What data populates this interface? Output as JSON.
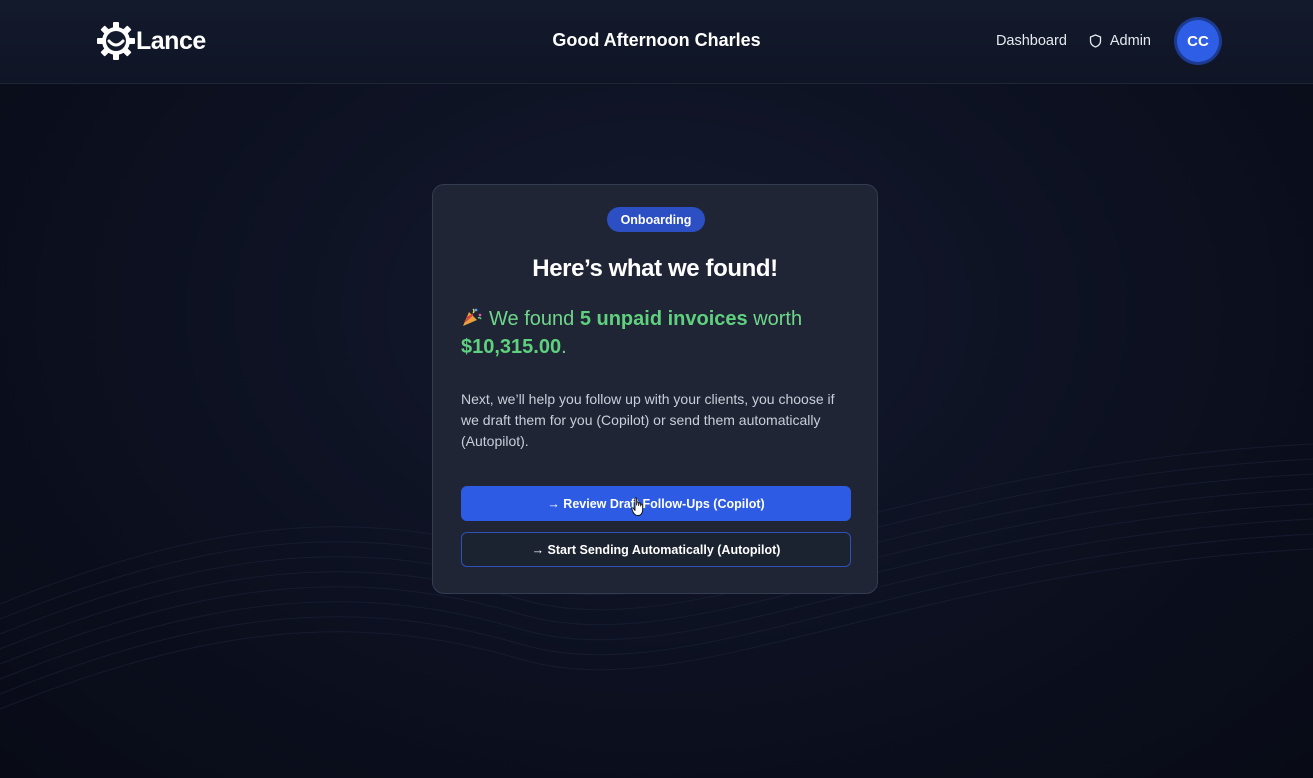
{
  "header": {
    "logo_text": "Lance",
    "greeting": "Good Afternoon Charles",
    "nav": {
      "dashboard_label": "Dashboard",
      "admin_label": "Admin",
      "avatar_initials": "CC"
    }
  },
  "card": {
    "badge": "Onboarding",
    "title": "Here’s what we found!",
    "found": {
      "prefix": "We found",
      "count_text": "5 unpaid invoices",
      "middle": "worth",
      "amount": "$10,315.00",
      "suffix": "."
    },
    "description": "Next, we’ll help you follow up with your clients, you choose if we draft them for you (Copilot) or send them automatically (Autopilot).",
    "buttons": {
      "primary_label": "→ Review Draft Follow-Ups (Copilot)",
      "secondary_label": "→ Start Sending Automatically (Autopilot)"
    }
  },
  "icons": {
    "logo": "gear-smile-icon",
    "admin": "shield-icon",
    "celebration": "party-popper-icon",
    "pointer": "hand-cursor-icon"
  },
  "colors": {
    "accent": "#2d5be3",
    "success_text": "#5fd17e",
    "background": "#0c1020",
    "card": "#1f2535"
  }
}
